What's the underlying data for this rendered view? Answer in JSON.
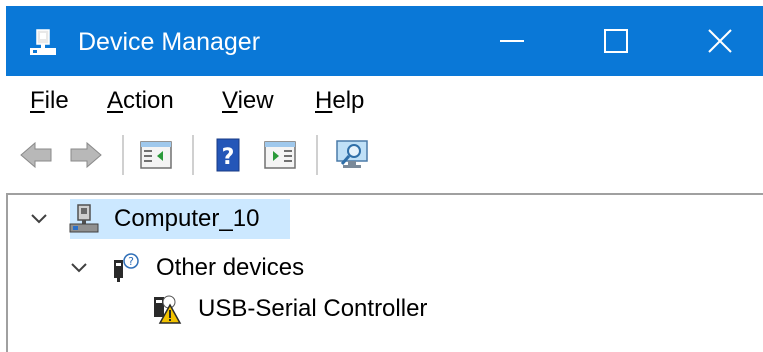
{
  "window": {
    "title": "Device Manager",
    "accent_color": "#0a78d7",
    "title_icon": "device-manager-icon",
    "controls": [
      "minimize-icon",
      "maximize-icon",
      "close-icon"
    ]
  },
  "menu": {
    "file": {
      "access_key": "F",
      "rest": "ile"
    },
    "action": {
      "access_key": "A",
      "rest": "ction"
    },
    "view": {
      "access_key": "V",
      "rest": "iew"
    },
    "help": {
      "access_key": "H",
      "rest": "elp"
    }
  },
  "toolbar": {
    "buttons": [
      "back-arrow-icon",
      "forward-arrow-icon",
      "show-hide-console-tree-icon",
      "help-icon",
      "show-hide-action-pane-icon",
      "scan-hardware-icon"
    ]
  },
  "tree": {
    "root": {
      "label": "Computer_10",
      "expanded": true,
      "selected": true,
      "icon": "computer-icon"
    },
    "category": {
      "label": "Other devices",
      "expanded": true,
      "icon": "unknown-device-icon"
    },
    "device": {
      "label": "USB-Serial Controller",
      "icon": "warning-device-icon",
      "status_color": "#f2c200"
    }
  }
}
